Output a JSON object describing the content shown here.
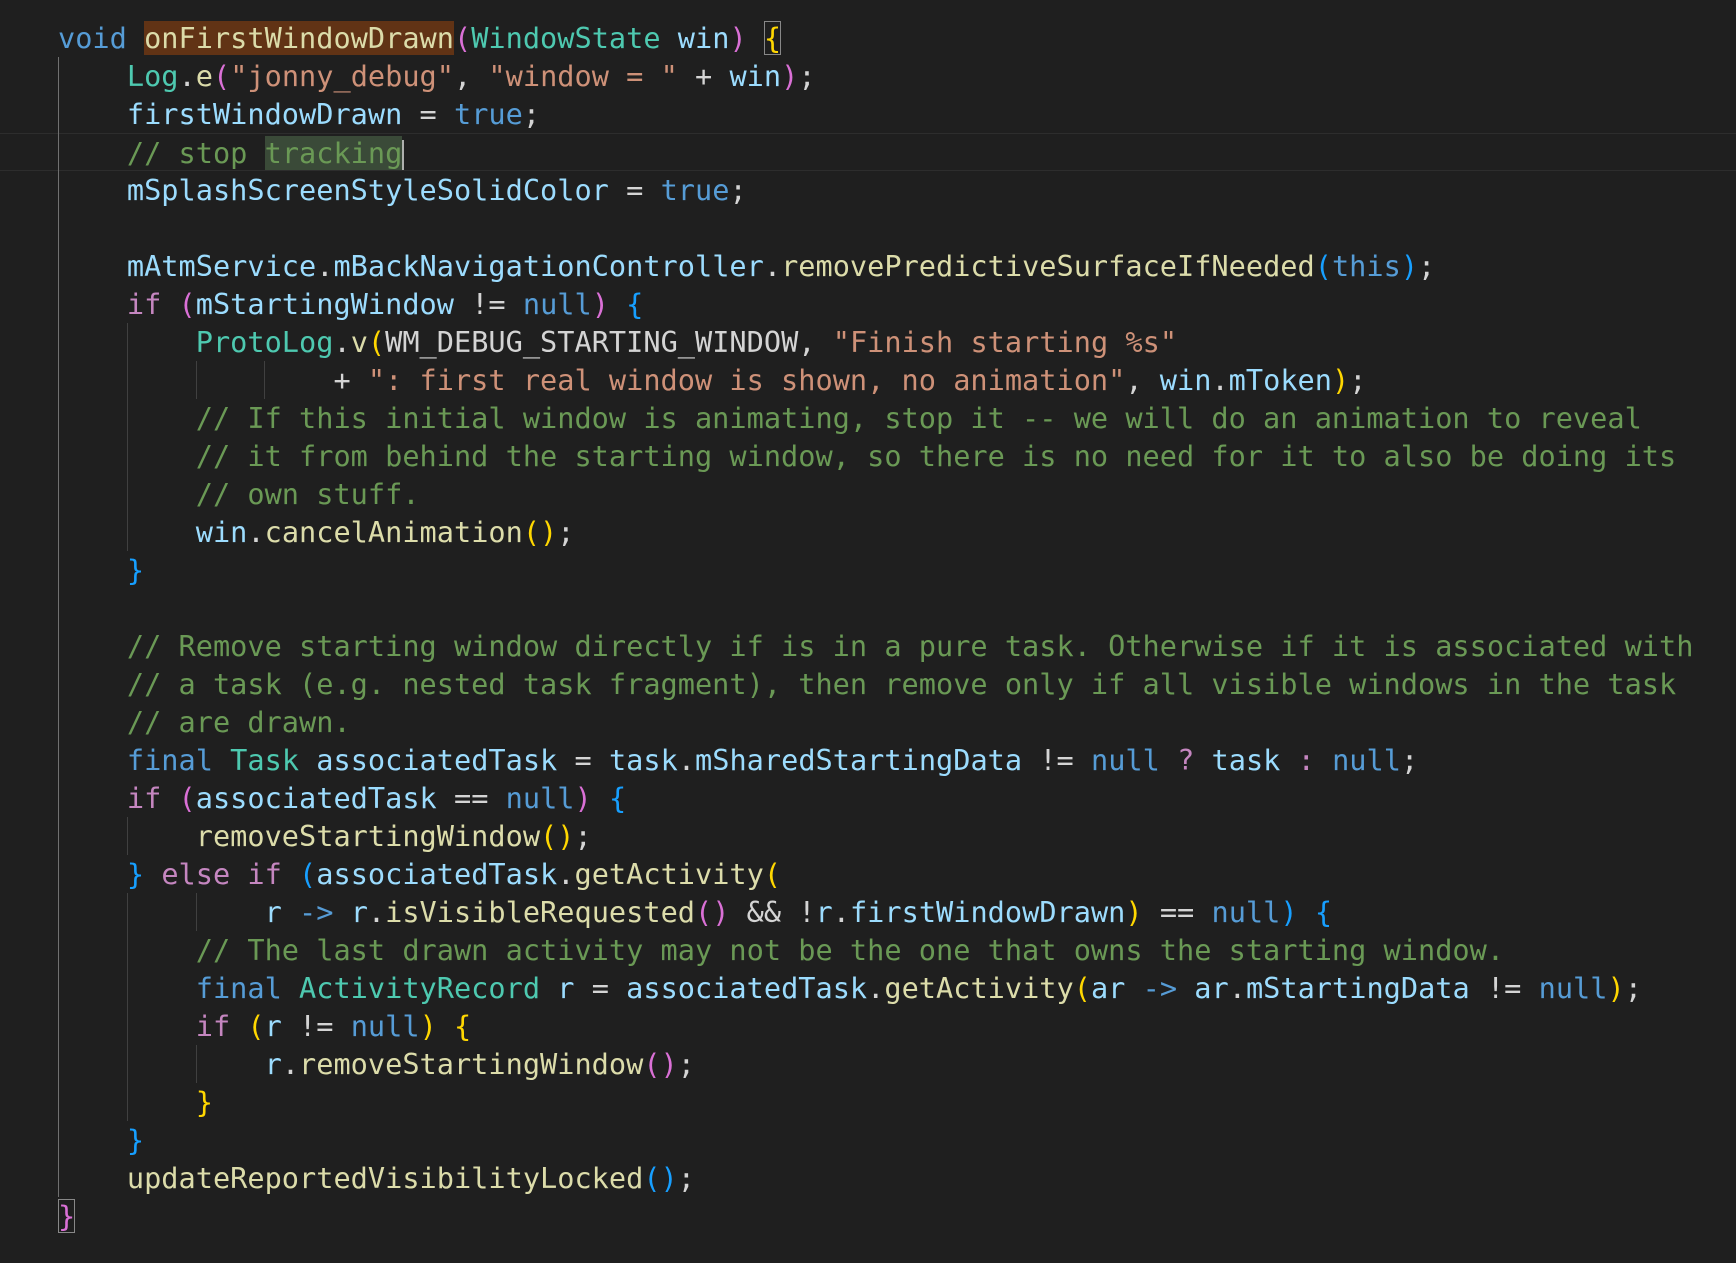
{
  "editor": {
    "colors": {
      "background": "#1f1f1f",
      "keyword": "#569cd6",
      "control": "#c586c0",
      "type": "#4ec9b0",
      "function": "#dcdcaa",
      "variable": "#9cdcfe",
      "string": "#ce9178",
      "comment": "#6a9955"
    },
    "lines": [
      [
        [
          "kw",
          "void"
        ],
        [
          "pl",
          " "
        ],
        [
          "fn hl-word",
          "onFirstWindowDrawn"
        ],
        [
          "br2",
          "("
        ],
        [
          "ty",
          "WindowState"
        ],
        [
          "pl",
          " "
        ],
        [
          "var",
          "win"
        ],
        [
          "br2",
          ")"
        ],
        [
          "pl",
          " "
        ],
        [
          "br1 bm",
          "{"
        ]
      ],
      [
        [
          "pl",
          "    "
        ],
        [
          "ty",
          "Log"
        ],
        [
          "pl",
          "."
        ],
        [
          "fn",
          "e"
        ],
        [
          "br2",
          "("
        ],
        [
          "str",
          "\"jonny_debug\""
        ],
        [
          "pl",
          ", "
        ],
        [
          "str",
          "\"window = \""
        ],
        [
          "pl",
          " + "
        ],
        [
          "var",
          "win"
        ],
        [
          "br2",
          ")"
        ],
        [
          "pl",
          ";"
        ]
      ],
      [
        [
          "pl",
          "    "
        ],
        [
          "var",
          "firstWindowDrawn"
        ],
        [
          "pl",
          " = "
        ],
        [
          "kw",
          "true"
        ],
        [
          "pl",
          ";"
        ]
      ],
      [
        [
          "pl",
          "    "
        ],
        [
          "com",
          "// stop "
        ],
        [
          "hl-sel",
          "tracking"
        ]
      ],
      [
        [
          "pl",
          "    "
        ],
        [
          "var",
          "mSplashScreenStyleSolidColor"
        ],
        [
          "pl",
          " = "
        ],
        [
          "kw",
          "true"
        ],
        [
          "pl",
          ";"
        ]
      ],
      [],
      [
        [
          "pl",
          "    "
        ],
        [
          "var",
          "mAtmService"
        ],
        [
          "pl",
          "."
        ],
        [
          "var",
          "mBackNavigationController"
        ],
        [
          "pl",
          "."
        ],
        [
          "fn",
          "removePredictiveSurfaceIfNeeded"
        ],
        [
          "br3",
          "("
        ],
        [
          "kw",
          "this"
        ],
        [
          "br3",
          ")"
        ],
        [
          "pl",
          ";"
        ]
      ],
      [
        [
          "pl",
          "    "
        ],
        [
          "kw2",
          "if"
        ],
        [
          "pl",
          " "
        ],
        [
          "br2",
          "("
        ],
        [
          "var",
          "mStartingWindow"
        ],
        [
          "pl",
          " != "
        ],
        [
          "kw",
          "null"
        ],
        [
          "br2",
          ")"
        ],
        [
          "pl",
          " "
        ],
        [
          "br3",
          "{"
        ]
      ],
      [
        [
          "pl",
          "        "
        ],
        [
          "ty",
          "ProtoLog"
        ],
        [
          "pl",
          "."
        ],
        [
          "fn",
          "v"
        ],
        [
          "br1",
          "("
        ],
        [
          "pl",
          "WM_DEBUG_STARTING_WINDOW"
        ],
        [
          "pl",
          ", "
        ],
        [
          "str",
          "\"Finish starting %s\""
        ]
      ],
      [
        [
          "pl",
          "                "
        ],
        [
          "pl",
          "+ "
        ],
        [
          "str",
          "\": first real window is shown, no animation\""
        ],
        [
          "pl",
          ", "
        ],
        [
          "var",
          "win"
        ],
        [
          "pl",
          "."
        ],
        [
          "var",
          "mToken"
        ],
        [
          "br1",
          ")"
        ],
        [
          "pl",
          ";"
        ]
      ],
      [
        [
          "pl",
          "        "
        ],
        [
          "com",
          "// If this initial window is animating, stop it -- we will do an animation to reveal"
        ]
      ],
      [
        [
          "pl",
          "        "
        ],
        [
          "com",
          "// it from behind the starting window, so there is no need for it to also be doing its"
        ]
      ],
      [
        [
          "pl",
          "        "
        ],
        [
          "com",
          "// own stuff."
        ]
      ],
      [
        [
          "pl",
          "        "
        ],
        [
          "var",
          "win"
        ],
        [
          "pl",
          "."
        ],
        [
          "fn",
          "cancelAnimation"
        ],
        [
          "br1",
          "()"
        ],
        [
          "pl",
          ";"
        ]
      ],
      [
        [
          "pl",
          "    "
        ],
        [
          "br3",
          "}"
        ]
      ],
      [],
      [
        [
          "pl",
          "    "
        ],
        [
          "com",
          "// Remove starting window directly if is in a pure task. Otherwise if it is associated with"
        ]
      ],
      [
        [
          "pl",
          "    "
        ],
        [
          "com",
          "// a task (e.g. nested task fragment), then remove only if all visible windows in the task"
        ]
      ],
      [
        [
          "pl",
          "    "
        ],
        [
          "com",
          "// are drawn."
        ]
      ],
      [
        [
          "pl",
          "    "
        ],
        [
          "kw",
          "final"
        ],
        [
          "pl",
          " "
        ],
        [
          "ty",
          "Task"
        ],
        [
          "pl",
          " "
        ],
        [
          "var",
          "associatedTask"
        ],
        [
          "pl",
          " = "
        ],
        [
          "var",
          "task"
        ],
        [
          "pl",
          "."
        ],
        [
          "var",
          "mSharedStartingData"
        ],
        [
          "pl",
          " != "
        ],
        [
          "kw",
          "null"
        ],
        [
          "pl",
          " "
        ],
        [
          "kw2",
          "?"
        ],
        [
          "pl",
          " "
        ],
        [
          "var",
          "task"
        ],
        [
          "pl",
          " "
        ],
        [
          "kw2",
          ":"
        ],
        [
          "pl",
          " "
        ],
        [
          "kw",
          "null"
        ],
        [
          "pl",
          ";"
        ]
      ],
      [
        [
          "pl",
          "    "
        ],
        [
          "kw2",
          "if"
        ],
        [
          "pl",
          " "
        ],
        [
          "br2",
          "("
        ],
        [
          "var",
          "associatedTask"
        ],
        [
          "pl",
          " == "
        ],
        [
          "kw",
          "null"
        ],
        [
          "br2",
          ")"
        ],
        [
          "pl",
          " "
        ],
        [
          "br3",
          "{"
        ]
      ],
      [
        [
          "pl",
          "        "
        ],
        [
          "fn",
          "removeStartingWindow"
        ],
        [
          "br1",
          "()"
        ],
        [
          "pl",
          ";"
        ]
      ],
      [
        [
          "pl",
          "    "
        ],
        [
          "br3",
          "}"
        ],
        [
          "pl",
          " "
        ],
        [
          "kw2",
          "else if"
        ],
        [
          "pl",
          " "
        ],
        [
          "br3",
          "("
        ],
        [
          "var",
          "associatedTask"
        ],
        [
          "pl",
          "."
        ],
        [
          "fn",
          "getActivity"
        ],
        [
          "br1",
          "("
        ]
      ],
      [
        [
          "pl",
          "            "
        ],
        [
          "var",
          "r"
        ],
        [
          "pl",
          " "
        ],
        [
          "kw",
          "->"
        ],
        [
          "pl",
          " "
        ],
        [
          "var",
          "r"
        ],
        [
          "pl",
          "."
        ],
        [
          "fn",
          "isVisibleRequested"
        ],
        [
          "br2",
          "()"
        ],
        [
          "pl",
          " && !"
        ],
        [
          "var",
          "r"
        ],
        [
          "pl",
          "."
        ],
        [
          "var",
          "firstWindowDrawn"
        ],
        [
          "br1",
          ")"
        ],
        [
          "pl",
          " == "
        ],
        [
          "kw",
          "null"
        ],
        [
          "br3",
          ")"
        ],
        [
          "pl",
          " "
        ],
        [
          "br3",
          "{"
        ]
      ],
      [
        [
          "pl",
          "        "
        ],
        [
          "com",
          "// The last drawn activity may not be the one that owns the starting window."
        ]
      ],
      [
        [
          "pl",
          "        "
        ],
        [
          "kw",
          "final"
        ],
        [
          "pl",
          " "
        ],
        [
          "ty",
          "ActivityRecord"
        ],
        [
          "pl",
          " "
        ],
        [
          "var",
          "r"
        ],
        [
          "pl",
          " = "
        ],
        [
          "var",
          "associatedTask"
        ],
        [
          "pl",
          "."
        ],
        [
          "fn",
          "getActivity"
        ],
        [
          "br1",
          "("
        ],
        [
          "var",
          "ar"
        ],
        [
          "pl",
          " "
        ],
        [
          "kw",
          "->"
        ],
        [
          "pl",
          " "
        ],
        [
          "var",
          "ar"
        ],
        [
          "pl",
          "."
        ],
        [
          "var",
          "mStartingData"
        ],
        [
          "pl",
          " != "
        ],
        [
          "kw",
          "null"
        ],
        [
          "br1",
          ")"
        ],
        [
          "pl",
          ";"
        ]
      ],
      [
        [
          "pl",
          "        "
        ],
        [
          "kw2",
          "if"
        ],
        [
          "pl",
          " "
        ],
        [
          "br1",
          "("
        ],
        [
          "var",
          "r"
        ],
        [
          "pl",
          " != "
        ],
        [
          "kw",
          "null"
        ],
        [
          "br1",
          ")"
        ],
        [
          "pl",
          " "
        ],
        [
          "br1",
          "{"
        ]
      ],
      [
        [
          "pl",
          "            "
        ],
        [
          "var",
          "r"
        ],
        [
          "pl",
          "."
        ],
        [
          "fn",
          "removeStartingWindow"
        ],
        [
          "br2",
          "()"
        ],
        [
          "pl",
          ";"
        ]
      ],
      [
        [
          "pl",
          "        "
        ],
        [
          "br1",
          "}"
        ]
      ],
      [
        [
          "pl",
          "    "
        ],
        [
          "br3",
          "}"
        ]
      ],
      [
        [
          "pl",
          "    "
        ],
        [
          "fn",
          "updateReportedVisibilityLocked"
        ],
        [
          "br3",
          "()"
        ],
        [
          "pl",
          ";"
        ]
      ],
      [
        [
          "br2 bm",
          "}"
        ]
      ]
    ]
  }
}
